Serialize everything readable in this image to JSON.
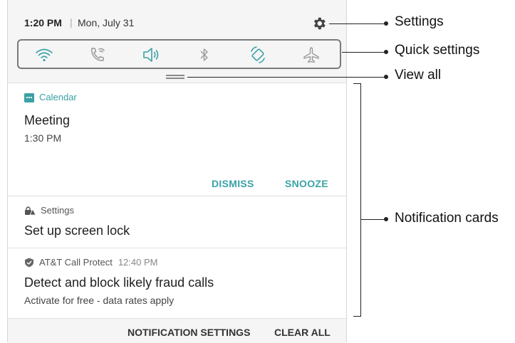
{
  "status_bar": {
    "time": "1:20 PM",
    "separator": "|",
    "date": "Mon, July 31"
  },
  "quick_settings_icons": [
    "wifi-icon",
    "wifi-calling-icon",
    "sound-icon",
    "bluetooth-icon",
    "auto-rotate-icon",
    "airplane-mode-icon"
  ],
  "cards": {
    "calendar": {
      "app": "Calendar",
      "title": "Meeting",
      "time": "1:30 PM",
      "dismiss": "DISMISS",
      "snooze": "SNOOZE"
    },
    "settings": {
      "app": "Settings",
      "title": "Set up screen lock"
    },
    "att": {
      "app": "AT&T Call Protect",
      "time": "12:40 PM",
      "title": "Detect and block likely fraud calls",
      "subtitle": "Activate for free - data rates apply"
    }
  },
  "bottom_bar": {
    "notification_settings": "NOTIFICATION SETTINGS",
    "clear_all": "CLEAR ALL"
  },
  "callouts": {
    "settings": "Settings",
    "quick_settings": "Quick settings",
    "view_all": "View all",
    "notification_cards": "Notification cards"
  },
  "colors": {
    "accent": "#3aa2a6",
    "panel_bg": "#f5f5f5",
    "card_bg": "#ffffff"
  }
}
